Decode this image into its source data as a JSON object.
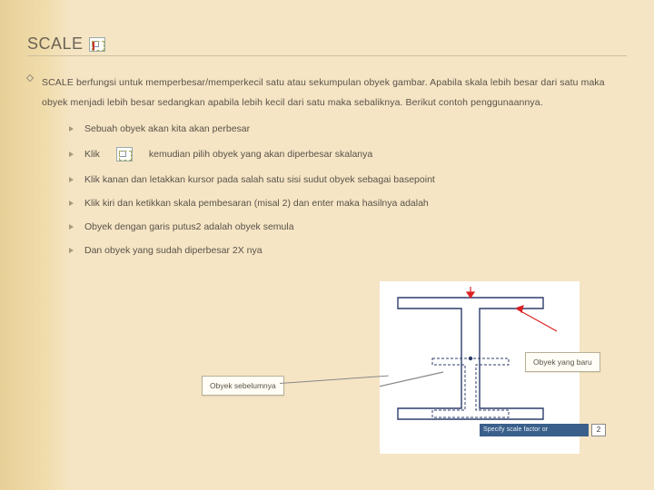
{
  "heading": "SCALE",
  "intro": "SCALE berfungsi untuk memperbesar/memperkecil satu atau sekumpulan obyek gambar. Apabila skala lebih besar dari satu maka obyek menjadi lebih besar sedangkan apabila lebih kecil dari satu maka sebaliknya. Berikut contoh penggunaannya.",
  "steps": {
    "s1": "Sebuah obyek akan kita akan perbesar",
    "s2a": "Klik",
    "s2b": "kemudian pilih obyek yang akan diperbesar skalanya",
    "s3": "Klik kanan dan letakkan kursor pada salah satu sisi sudut obyek sebagai basepoint",
    "s4": "Klik kiri dan ketikkan skala pembesaran (misal 2) dan enter maka hasilnya adalah",
    "s5": "Obyek dengan garis putus2 adalah obyek semula",
    "s6": "Dan obyek yang sudah diperbesar 2X nya"
  },
  "callouts": {
    "baru": "Obyek yang baru",
    "sebelum": "Obyek sebelumnya"
  },
  "prompt": {
    "label": "Specify scale factor or",
    "value": "2"
  }
}
